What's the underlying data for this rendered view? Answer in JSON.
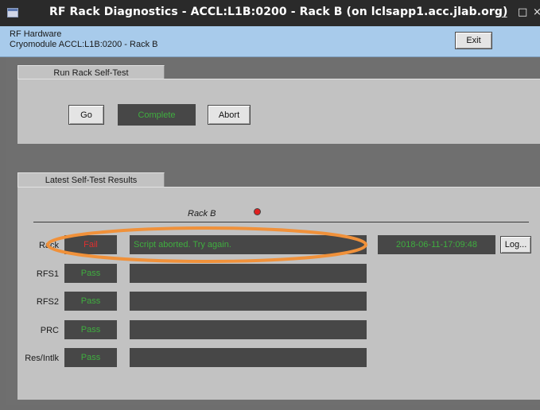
{
  "window": {
    "title": "RF Rack Diagnostics - ACCL:L1B:0200 - Rack B (on lclsapp1.acc.jlab.org)",
    "minimize_glyph": "_",
    "maximize_glyph": "□",
    "close_glyph": "×"
  },
  "header": {
    "line1": "RF Hardware",
    "line2": "Cryomodule ACCL:L1B:0200 - Rack B",
    "exit_label": "Exit"
  },
  "self_test": {
    "tab_label": "Run Rack Self-Test",
    "go_label": "Go",
    "status": "Complete",
    "status_color": "#3fae3f",
    "abort_label": "Abort"
  },
  "results": {
    "tab_label": "Latest Self-Test Results",
    "rack_title": "Rack B",
    "indicator_color": "#e02020",
    "rows": [
      {
        "label": "Rack",
        "result": "Fail",
        "result_color": "#e03030",
        "message": "Script aborted. Try again.",
        "timestamp": "2018-06-11-17:09:48",
        "log_label": "Log..."
      },
      {
        "label": "RFS1",
        "result": "Pass",
        "result_color": "#3fae3f",
        "message": ""
      },
      {
        "label": "RFS2",
        "result": "Pass",
        "result_color": "#3fae3f",
        "message": ""
      },
      {
        "label": "PRC",
        "result": "Pass",
        "result_color": "#3fae3f",
        "message": ""
      },
      {
        "label": "Res/Intlk",
        "result": "Pass",
        "result_color": "#3fae3f",
        "message": ""
      }
    ],
    "message_color": "#3fae3f",
    "highlight_color": "#f0913a"
  }
}
